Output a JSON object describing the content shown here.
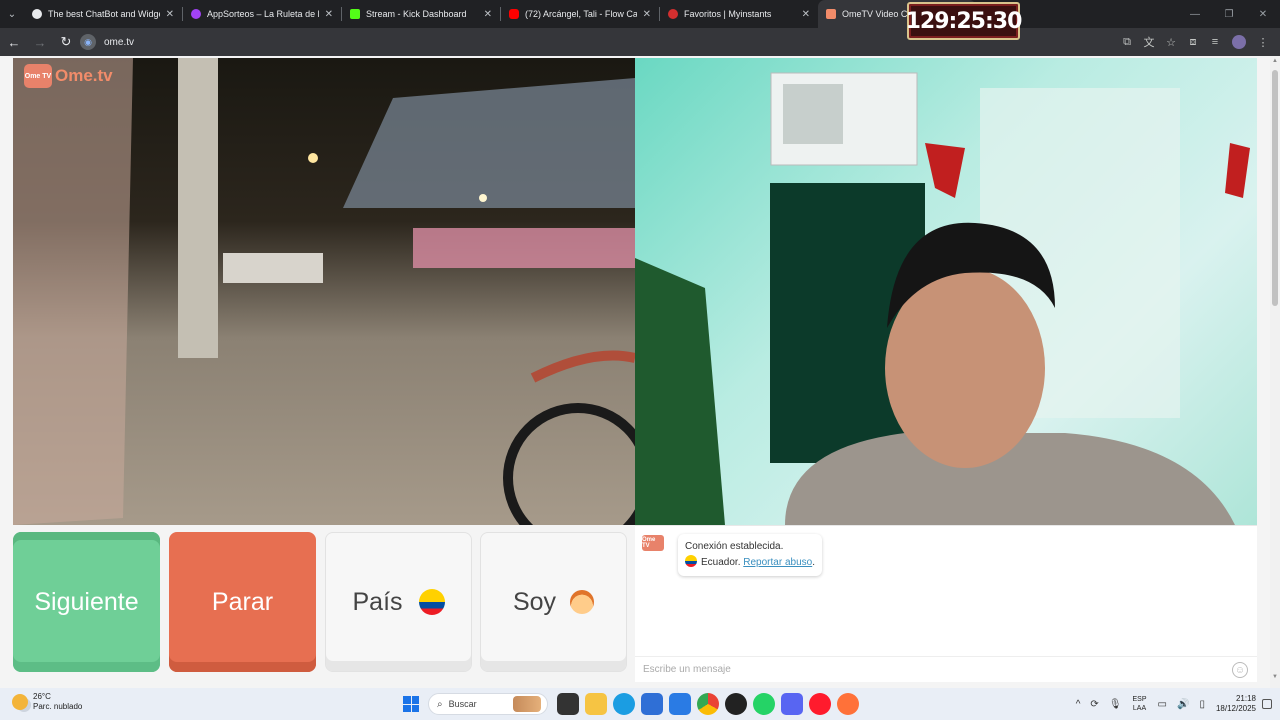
{
  "browser": {
    "tabs": [
      {
        "title": "The best ChatBot and Widgets",
        "favicon_color": "#e8eaed",
        "active": false
      },
      {
        "title": "AppSorteos – La Ruleta de la Su",
        "favicon_color": "#a142f4",
        "active": false
      },
      {
        "title": "Stream - Kick Dashboard",
        "favicon_color": "#53fc18",
        "active": false
      },
      {
        "title": "(72) Arcángel, Tali - Flow Cabró",
        "favicon_color": "#ff0000",
        "active": false
      },
      {
        "title": "Favoritos | Myinstants",
        "favicon_color": "#d32f2f",
        "active": false
      },
      {
        "title": "OmeTV Video Cha",
        "favicon_color": "#f28c6a",
        "active": true
      }
    ],
    "url": "ome.tv",
    "timer_overlay": "129:25:30"
  },
  "app": {
    "logo_badge": "Ome TV",
    "logo_text": "Ome.tv",
    "buttons": {
      "next": "Siguiente",
      "stop": "Parar",
      "country": "País",
      "gender": "Soy"
    },
    "chat": {
      "logo_badge": "Ome TV",
      "status": "Conexión establecida.",
      "country": "Ecuador.",
      "report": "Reportar abuso",
      "report_suffix": ".",
      "placeholder": "Escribe un mensaje"
    },
    "colors": {
      "next": "#6fcf97",
      "stop": "#e76f51",
      "accent": "#f28c6a"
    }
  },
  "taskbar": {
    "weather_temp": "26°C",
    "weather_desc": "Parc. nublado",
    "search_placeholder": "Buscar",
    "lang_1": "ESP",
    "lang_2": "LAA",
    "time": "21:18",
    "date": "18/12/2025"
  }
}
